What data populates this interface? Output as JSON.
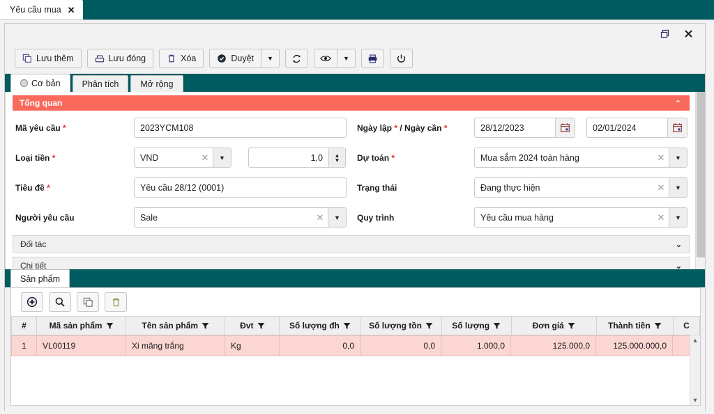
{
  "app_tab": {
    "title": "Yêu cầu mua",
    "close_icon": "close-icon"
  },
  "window_buttons": {
    "restore": "restore-window-icon",
    "close": "close-window-icon"
  },
  "toolbar": {
    "save_add_label": "Lưu thêm",
    "save_close_label": "Lưu đóng",
    "delete_label": "Xóa",
    "approve_label": "Duyệt",
    "approve_caret": "▼",
    "refresh_icon": "refresh-icon",
    "view_icon": "eye-icon",
    "view_caret": "▼",
    "print_icon": "printer-icon",
    "power_icon": "power-icon"
  },
  "tabs": [
    {
      "label": "Cơ bản",
      "active": true
    },
    {
      "label": "Phân tích",
      "active": false
    },
    {
      "label": "Mở rộng",
      "active": false
    }
  ],
  "sections": {
    "overview": {
      "title": "Tổng quan",
      "chevron": "⌃",
      "expanded": true
    },
    "partner": {
      "title": "Đối tác",
      "chevron": "⌄",
      "expanded": false
    },
    "detail": {
      "title": "Chi tiết",
      "chevron": "⌄",
      "expanded": false
    }
  },
  "form": {
    "ma_yeu_cau": {
      "label": "Mã yêu cầu",
      "required": "*",
      "value": "2023YCM108"
    },
    "ngay": {
      "label": "Ngày lập",
      "required": "*",
      "label2": "/ Ngày cần",
      "required2": "*",
      "value": "28/12/2023",
      "value2": "02/01/2024",
      "icon": "calendar-icon"
    },
    "loai_tien": {
      "label": "Loại tiền",
      "required": "*",
      "value": "VND",
      "clear": "✕",
      "caret": "▼",
      "rate_value": "1,0"
    },
    "du_toan": {
      "label": "Dự toán",
      "required": "*",
      "value": "Mua sắm 2024 toàn hàng",
      "clear": "✕",
      "caret": "▼"
    },
    "tieu_de": {
      "label": "Tiêu đề",
      "required": "*",
      "value": "Yêu cầu 28/12 (0001)"
    },
    "trang_thai": {
      "label": "Trạng thái",
      "required": "",
      "value": "Đang thực hiện",
      "clear": "✕",
      "caret": "▼"
    },
    "nguoi_yeu_cau": {
      "label": "Người yêu cầu",
      "required": "",
      "value": "Sale",
      "clear": "✕",
      "caret": "▼"
    },
    "quy_trinh": {
      "label": "Quy trình",
      "required": "",
      "value": "Yêu cầu mua hàng",
      "clear": "✕",
      "caret": "▼"
    }
  },
  "product_tab": {
    "label": "Sản phẩm"
  },
  "grid_toolbar": {
    "add_icon": "add-circle-icon",
    "search_icon": "search-icon",
    "copy_icon": "copy-icon",
    "delete_icon": "trash-icon"
  },
  "grid": {
    "columns": [
      {
        "label": "#",
        "filter": false,
        "align": "c"
      },
      {
        "label": "Mã sản phẩm",
        "filter": true,
        "align": "l"
      },
      {
        "label": "Tên sản phẩm",
        "filter": true,
        "align": "l"
      },
      {
        "label": "Đvt",
        "filter": true,
        "align": "l"
      },
      {
        "label": "Số lượng đh",
        "filter": true,
        "align": "r"
      },
      {
        "label": "Số lượng tồn",
        "filter": true,
        "align": "r"
      },
      {
        "label": "Số lượng",
        "filter": true,
        "align": "r"
      },
      {
        "label": "Đơn giá",
        "filter": true,
        "align": "r"
      },
      {
        "label": "Thành tiền",
        "filter": true,
        "align": "r"
      },
      {
        "label": "C",
        "filter": false,
        "align": "c"
      }
    ],
    "rows": [
      {
        "index": "1",
        "ma_san_pham": "VL00119",
        "ten_san_pham": "Xi măng trắng",
        "dvt": "Kg",
        "so_luong_dh": "0,0",
        "so_luong_ton": "0,0",
        "so_luong": "1.000,0",
        "don_gia": "125.000,0",
        "thanh_tien": "125.000.000,0",
        "c": ""
      }
    ],
    "filter_icon": "filter-icon",
    "scroll_up_icon": "▲",
    "scroll_down_icon": "▼"
  },
  "colors": {
    "teal": "#005b61",
    "section_red": "#f96a5d",
    "row_pink": "#fcd6d2",
    "header_gray": "#efefef"
  }
}
